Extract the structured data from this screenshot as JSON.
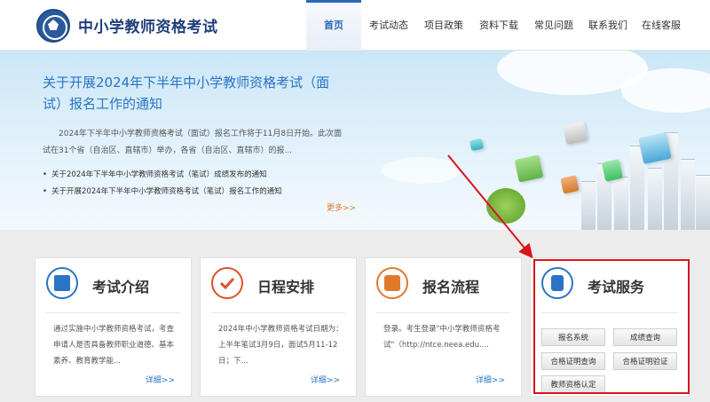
{
  "header": {
    "site_title": "中小学教师资格考试",
    "nav": [
      "首页",
      "考试动态",
      "项目政策",
      "资料下载",
      "常见问题",
      "联系我们",
      "在线客服"
    ]
  },
  "banner": {
    "headline": "关于开展2024年下半年中小学教师资格考试（面试）报名工作的通知",
    "summary": "2024年下半年中小学教师资格考试（面试）报名工作将于11月8日开始。此次面试在31个省（自治区、直辖市）举办，各省（自治区、直辖市）的报...",
    "news": [
      "关于2024年下半年中小学教师资格考试（笔试）成绩发布的通知",
      "关于开展2024年下半年中小学教师资格考试（笔试）报名工作的通知"
    ],
    "more": "更多>>"
  },
  "cards": [
    {
      "title": "考试介绍",
      "icon": "document-icon",
      "color": "#2a74c4",
      "desc": "通过实施中小学教师资格考试，考查申请人是否具备教师职业道德、基本素养、教育教学能...",
      "more": "详细>>"
    },
    {
      "title": "日程安排",
      "icon": "checkmark-icon",
      "color": "#e0502a",
      "desc": "2024年中小学教师资格考试日期为：上半年笔试3月9日，面试5月11-12日；下...",
      "more": "详细>>"
    },
    {
      "title": "报名流程",
      "icon": "form-icon",
      "color": "#e07a2a",
      "desc": "登录。考生登录\"中小学教师资格考试\"（http://ntce.neea.edu....",
      "more": "详细>>"
    }
  ],
  "service": {
    "title": "考试服务",
    "icon": "contact-book-icon",
    "buttons": [
      "报名系统",
      "成绩查询",
      "合格证明查询",
      "合格证明验证",
      "教师资格认定"
    ]
  },
  "colors": {
    "brand": "#1f3f7a",
    "accent": "#2a74c4",
    "highlight": "#d9141c"
  }
}
